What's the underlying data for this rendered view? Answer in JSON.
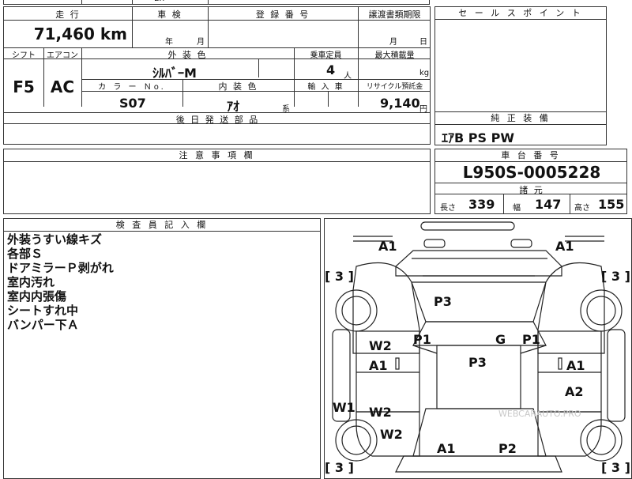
{
  "top_row": {
    "cut_text": "ЁЯ"
  },
  "sheet": {
    "mileage": {
      "label": "走 行",
      "value": "71,460 km"
    },
    "inspection": {
      "label": "車 検",
      "year_unit": "年",
      "month_unit": "月"
    },
    "registration": {
      "label": "登 録 番 号",
      "value": ""
    },
    "transfer": {
      "label": "譲渡書類期限",
      "month_unit": "月",
      "day_unit": "日"
    },
    "shift": {
      "label": "シフト",
      "value": "F5"
    },
    "aircon": {
      "label": "エアコン",
      "value": "AC"
    },
    "exterior_color": {
      "label": "外 装 色",
      "value": "ｼﾙﾊﾞｰM"
    },
    "color_no": {
      "label": "カ ラ ー Ｎo.",
      "value": "S07"
    },
    "interior_color": {
      "label": "内 装 色",
      "value": "ｱｵ",
      "suffix": "系"
    },
    "capacity": {
      "label": "乗車定員",
      "value": "4",
      "unit": "人"
    },
    "max_load": {
      "label": "最大積載量",
      "unit": "kg"
    },
    "import": {
      "label": "輸 入 車"
    },
    "recycle": {
      "label": "リサイクル預託金",
      "value": "9,140",
      "unit": "円"
    },
    "later_parts": {
      "label": "後 日 発 送 部 品"
    },
    "notes": {
      "label": "注 意 事 項 欄"
    },
    "inspector": {
      "label": "検 査 員 記 入 欄",
      "remarks": [
        "外装うすい線キズ",
        "各部Ｓ",
        "ドアミラーＰ剥がれ",
        "室内汚れ",
        "室内内張傷",
        "シートすれ中",
        "バンパー下Ａ"
      ]
    }
  },
  "side": {
    "sales_point": {
      "label": "セ ー ル ス ポ イ ン ト"
    },
    "equipment": {
      "label": "純 正 装 備",
      "value": "ｴｱB PS PW"
    },
    "chassis": {
      "label": "車 台 番 号",
      "value": "L950S-0005228"
    },
    "specs": {
      "label": "諸 元",
      "length_label": "長さ",
      "length": "339",
      "width_label": "幅",
      "width": "147",
      "height_label": "高さ",
      "height": "155"
    }
  },
  "diagram": {
    "marks": [
      "A1",
      "A1",
      "[ 3 ]",
      "[ 3 ]",
      "P3",
      "W2",
      "P1",
      "G",
      "P1",
      "A1",
      "P3",
      "A1",
      "A2",
      "W1",
      "W2",
      "W2",
      "A1",
      "P2",
      "[ 3 ]",
      "[ 3 ]"
    ],
    "watermark": "WEBCARAUTO.PRO"
  }
}
